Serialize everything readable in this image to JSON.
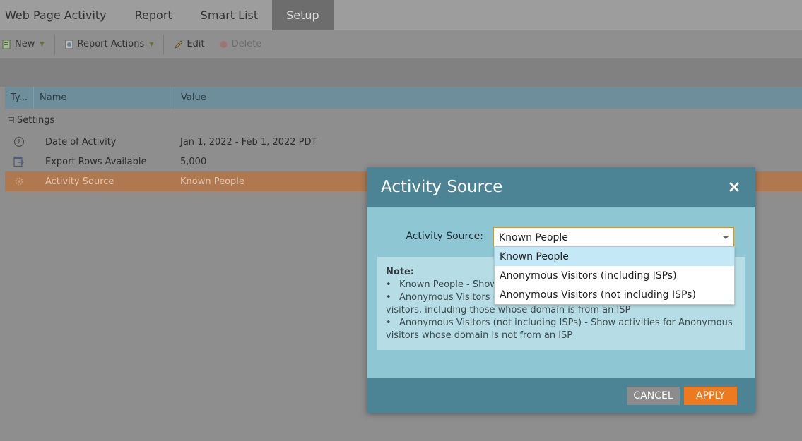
{
  "tabs": [
    {
      "label": "Web Page Activity"
    },
    {
      "label": "Report"
    },
    {
      "label": "Smart List"
    },
    {
      "label": "Setup"
    }
  ],
  "toolbar": {
    "new_label": "New",
    "report_actions_label": "Report Actions",
    "edit_label": "Edit",
    "delete_label": "Delete"
  },
  "grid": {
    "columns": [
      "Ty...",
      "Name",
      "Value"
    ],
    "group_label": "Settings",
    "rows": [
      {
        "icon": "clock-icon",
        "name": "Date of Activity",
        "value": "Jan 1, 2022 - Feb 1, 2022 PDT"
      },
      {
        "icon": "export-icon",
        "name": "Export Rows Available",
        "value": "5,000"
      },
      {
        "icon": "gear-icon",
        "name": "Activity Source",
        "value": "Known People"
      }
    ]
  },
  "modal": {
    "title": "Activity Source",
    "field_label": "Activity Source:",
    "selected_value": "Known People",
    "options": [
      "Known People",
      "Anonymous Visitors (including ISPs)",
      "Anonymous Visitors (not including ISPs)"
    ],
    "note_title": "Note:",
    "note_items": [
      "Known People - Show",
      "Anonymous Visitors (in",
      "visitors, including those whose domain is from an ISP",
      "Anonymous Visitors (not including ISPs) - Show activities for Anonymous",
      "visitors whose domain is not from an ISP"
    ],
    "cancel_label": "CANCEL",
    "apply_label": "APPLY"
  },
  "colors": {
    "selected_row": "#b0784f",
    "modal_header": "#4c8496",
    "modal_body": "#8ec6d4",
    "apply_button": "#ee7a1f"
  }
}
